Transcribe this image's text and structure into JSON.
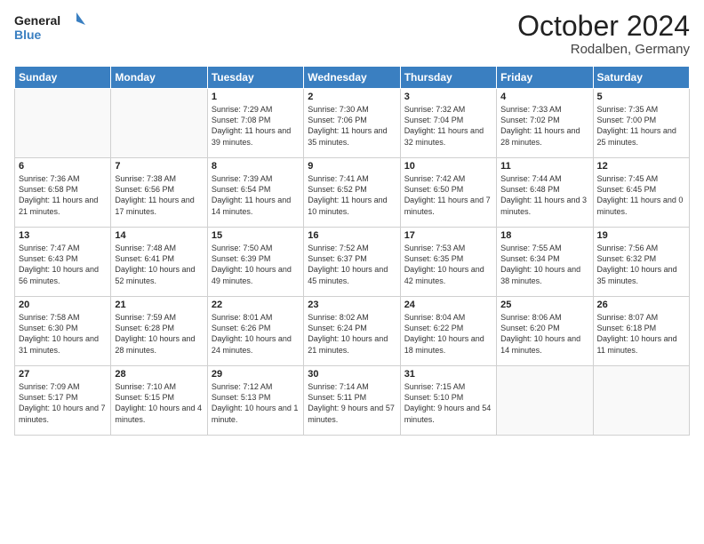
{
  "logo": {
    "line1": "General",
    "line2": "Blue"
  },
  "header": {
    "month": "October 2024",
    "location": "Rodalben, Germany"
  },
  "days_of_week": [
    "Sunday",
    "Monday",
    "Tuesday",
    "Wednesday",
    "Thursday",
    "Friday",
    "Saturday"
  ],
  "weeks": [
    [
      {
        "day": "",
        "sunrise": "",
        "sunset": "",
        "daylight": ""
      },
      {
        "day": "",
        "sunrise": "",
        "sunset": "",
        "daylight": ""
      },
      {
        "day": "1",
        "sunrise": "Sunrise: 7:29 AM",
        "sunset": "Sunset: 7:08 PM",
        "daylight": "Daylight: 11 hours and 39 minutes."
      },
      {
        "day": "2",
        "sunrise": "Sunrise: 7:30 AM",
        "sunset": "Sunset: 7:06 PM",
        "daylight": "Daylight: 11 hours and 35 minutes."
      },
      {
        "day": "3",
        "sunrise": "Sunrise: 7:32 AM",
        "sunset": "Sunset: 7:04 PM",
        "daylight": "Daylight: 11 hours and 32 minutes."
      },
      {
        "day": "4",
        "sunrise": "Sunrise: 7:33 AM",
        "sunset": "Sunset: 7:02 PM",
        "daylight": "Daylight: 11 hours and 28 minutes."
      },
      {
        "day": "5",
        "sunrise": "Sunrise: 7:35 AM",
        "sunset": "Sunset: 7:00 PM",
        "daylight": "Daylight: 11 hours and 25 minutes."
      }
    ],
    [
      {
        "day": "6",
        "sunrise": "Sunrise: 7:36 AM",
        "sunset": "Sunset: 6:58 PM",
        "daylight": "Daylight: 11 hours and 21 minutes."
      },
      {
        "day": "7",
        "sunrise": "Sunrise: 7:38 AM",
        "sunset": "Sunset: 6:56 PM",
        "daylight": "Daylight: 11 hours and 17 minutes."
      },
      {
        "day": "8",
        "sunrise": "Sunrise: 7:39 AM",
        "sunset": "Sunset: 6:54 PM",
        "daylight": "Daylight: 11 hours and 14 minutes."
      },
      {
        "day": "9",
        "sunrise": "Sunrise: 7:41 AM",
        "sunset": "Sunset: 6:52 PM",
        "daylight": "Daylight: 11 hours and 10 minutes."
      },
      {
        "day": "10",
        "sunrise": "Sunrise: 7:42 AM",
        "sunset": "Sunset: 6:50 PM",
        "daylight": "Daylight: 11 hours and 7 minutes."
      },
      {
        "day": "11",
        "sunrise": "Sunrise: 7:44 AM",
        "sunset": "Sunset: 6:48 PM",
        "daylight": "Daylight: 11 hours and 3 minutes."
      },
      {
        "day": "12",
        "sunrise": "Sunrise: 7:45 AM",
        "sunset": "Sunset: 6:45 PM",
        "daylight": "Daylight: 11 hours and 0 minutes."
      }
    ],
    [
      {
        "day": "13",
        "sunrise": "Sunrise: 7:47 AM",
        "sunset": "Sunset: 6:43 PM",
        "daylight": "Daylight: 10 hours and 56 minutes."
      },
      {
        "day": "14",
        "sunrise": "Sunrise: 7:48 AM",
        "sunset": "Sunset: 6:41 PM",
        "daylight": "Daylight: 10 hours and 52 minutes."
      },
      {
        "day": "15",
        "sunrise": "Sunrise: 7:50 AM",
        "sunset": "Sunset: 6:39 PM",
        "daylight": "Daylight: 10 hours and 49 minutes."
      },
      {
        "day": "16",
        "sunrise": "Sunrise: 7:52 AM",
        "sunset": "Sunset: 6:37 PM",
        "daylight": "Daylight: 10 hours and 45 minutes."
      },
      {
        "day": "17",
        "sunrise": "Sunrise: 7:53 AM",
        "sunset": "Sunset: 6:35 PM",
        "daylight": "Daylight: 10 hours and 42 minutes."
      },
      {
        "day": "18",
        "sunrise": "Sunrise: 7:55 AM",
        "sunset": "Sunset: 6:34 PM",
        "daylight": "Daylight: 10 hours and 38 minutes."
      },
      {
        "day": "19",
        "sunrise": "Sunrise: 7:56 AM",
        "sunset": "Sunset: 6:32 PM",
        "daylight": "Daylight: 10 hours and 35 minutes."
      }
    ],
    [
      {
        "day": "20",
        "sunrise": "Sunrise: 7:58 AM",
        "sunset": "Sunset: 6:30 PM",
        "daylight": "Daylight: 10 hours and 31 minutes."
      },
      {
        "day": "21",
        "sunrise": "Sunrise: 7:59 AM",
        "sunset": "Sunset: 6:28 PM",
        "daylight": "Daylight: 10 hours and 28 minutes."
      },
      {
        "day": "22",
        "sunrise": "Sunrise: 8:01 AM",
        "sunset": "Sunset: 6:26 PM",
        "daylight": "Daylight: 10 hours and 24 minutes."
      },
      {
        "day": "23",
        "sunrise": "Sunrise: 8:02 AM",
        "sunset": "Sunset: 6:24 PM",
        "daylight": "Daylight: 10 hours and 21 minutes."
      },
      {
        "day": "24",
        "sunrise": "Sunrise: 8:04 AM",
        "sunset": "Sunset: 6:22 PM",
        "daylight": "Daylight: 10 hours and 18 minutes."
      },
      {
        "day": "25",
        "sunrise": "Sunrise: 8:06 AM",
        "sunset": "Sunset: 6:20 PM",
        "daylight": "Daylight: 10 hours and 14 minutes."
      },
      {
        "day": "26",
        "sunrise": "Sunrise: 8:07 AM",
        "sunset": "Sunset: 6:18 PM",
        "daylight": "Daylight: 10 hours and 11 minutes."
      }
    ],
    [
      {
        "day": "27",
        "sunrise": "Sunrise: 7:09 AM",
        "sunset": "Sunset: 5:17 PM",
        "daylight": "Daylight: 10 hours and 7 minutes."
      },
      {
        "day": "28",
        "sunrise": "Sunrise: 7:10 AM",
        "sunset": "Sunset: 5:15 PM",
        "daylight": "Daylight: 10 hours and 4 minutes."
      },
      {
        "day": "29",
        "sunrise": "Sunrise: 7:12 AM",
        "sunset": "Sunset: 5:13 PM",
        "daylight": "Daylight: 10 hours and 1 minute."
      },
      {
        "day": "30",
        "sunrise": "Sunrise: 7:14 AM",
        "sunset": "Sunset: 5:11 PM",
        "daylight": "Daylight: 9 hours and 57 minutes."
      },
      {
        "day": "31",
        "sunrise": "Sunrise: 7:15 AM",
        "sunset": "Sunset: 5:10 PM",
        "daylight": "Daylight: 9 hours and 54 minutes."
      },
      {
        "day": "",
        "sunrise": "",
        "sunset": "",
        "daylight": ""
      },
      {
        "day": "",
        "sunrise": "",
        "sunset": "",
        "daylight": ""
      }
    ]
  ]
}
